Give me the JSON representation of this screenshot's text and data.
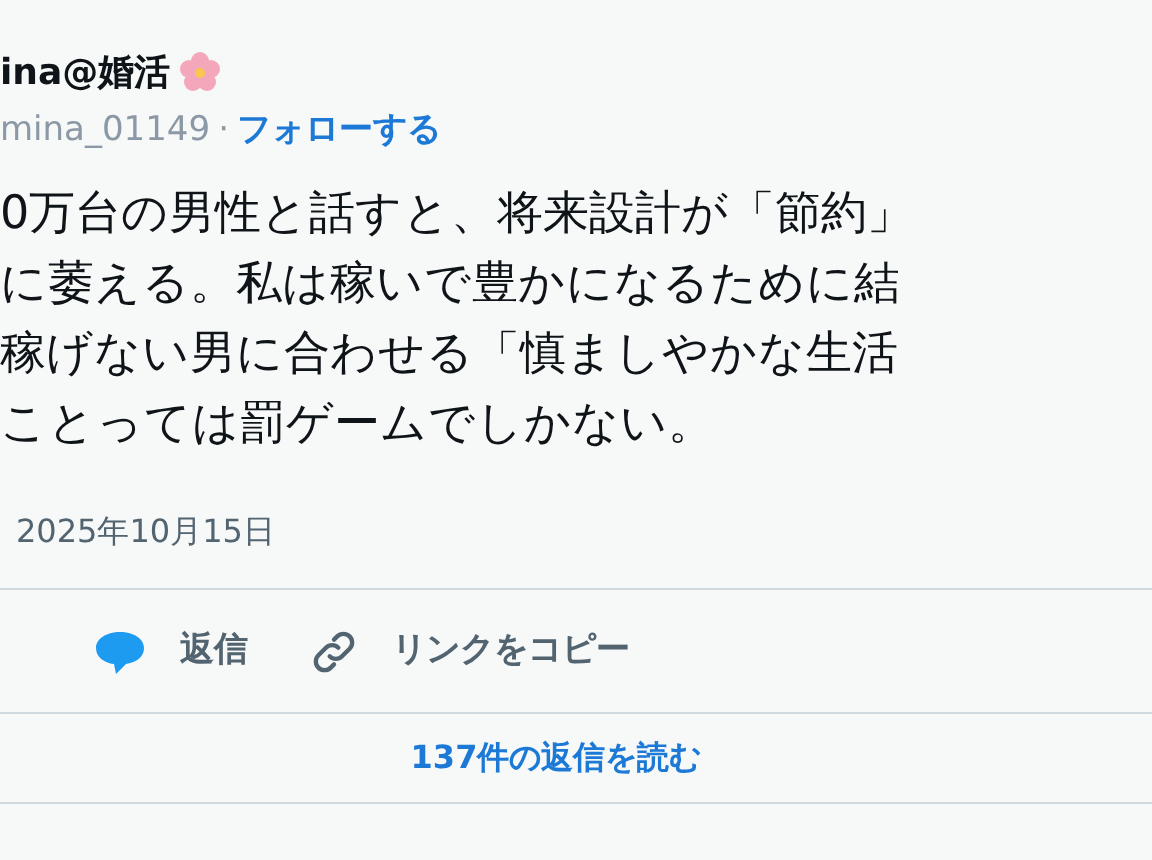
{
  "author": {
    "name": "ina@婚活",
    "handle": "mina_01149",
    "separator": "·",
    "follow": "フォローする"
  },
  "text_lines": [
    "0万台の男性と話すと、将来設計が「節約」",
    "に萎える。私は稼いで豊かになるために結",
    "稼げない男に合わせる「慎ましやかな生活",
    "ことっては罰ゲームでしかない。"
  ],
  "date": "2025年10月15日",
  "actions": [
    {
      "kind": "reply",
      "label": "返信"
    },
    {
      "kind": "copy_link",
      "label": "リンクをコピー"
    }
  ],
  "read_replies": "137件の返信を読む"
}
